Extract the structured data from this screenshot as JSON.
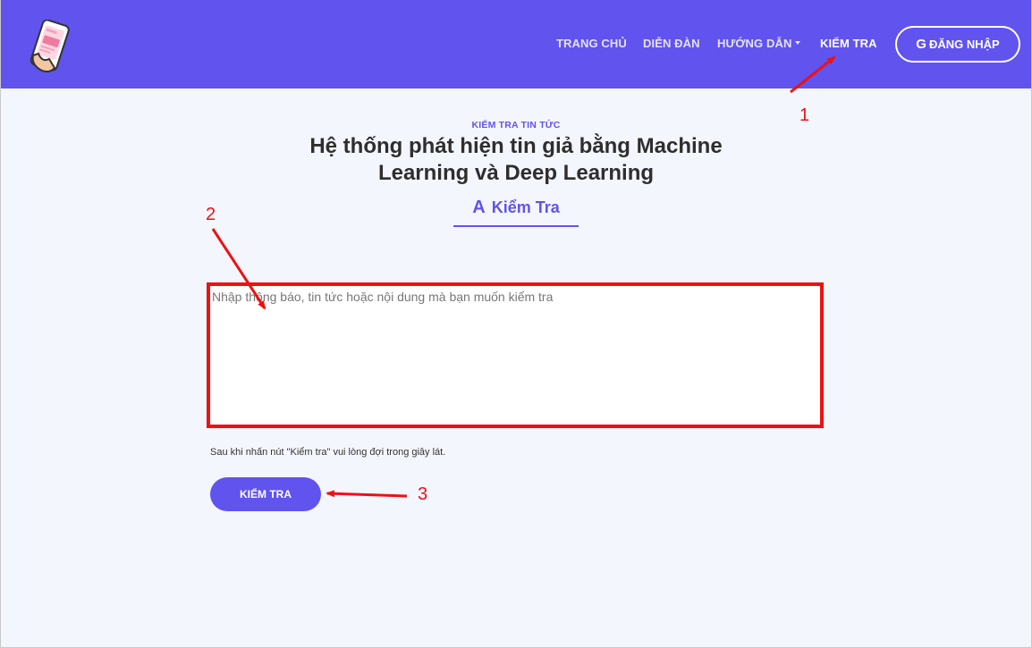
{
  "nav": {
    "items": [
      {
        "label": "TRANG CHỦ"
      },
      {
        "label": "DIỄN ĐÀN"
      },
      {
        "label": "HƯỚNG DẪN"
      },
      {
        "label": "KIỂM TRA"
      }
    ],
    "login_label": "ĐĂNG NHẬP",
    "login_icon": "G"
  },
  "hero": {
    "eyebrow": "KIỂM TRA TIN TỨC",
    "title": "Hệ thống phát hiện tin giả bằng Machine Learning và Deep Learning",
    "tab_label": "Kiểm Tra",
    "tab_icon": "A"
  },
  "form": {
    "placeholder": "Nhập thông báo, tin tức hoặc nội dung mà bạn muốn kiểm tra",
    "value": "",
    "hint": "Sau khi nhấn nút \"Kiểm tra\" vui lòng đợi trong giây lát.",
    "submit_label": "KIỂM TRA"
  },
  "annotations": [
    "1",
    "2",
    "3"
  ],
  "colors": {
    "brand": "#6153ee",
    "annotation": "#ee1111",
    "background": "#f4f6fe"
  }
}
